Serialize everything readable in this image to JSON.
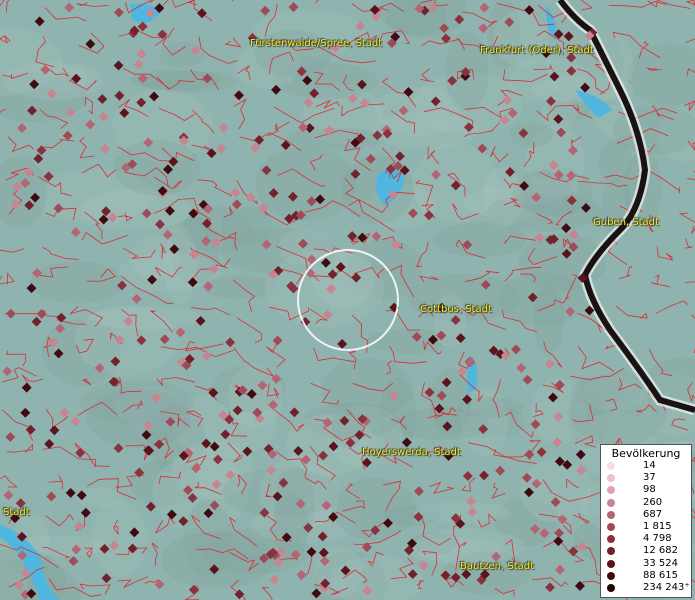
{
  "map": {
    "background_color": "#8fb3ae",
    "water_color": "#4fb6e0",
    "border_color": "#e0202a",
    "circle_color": "#ffffff"
  },
  "places": [
    {
      "id": "fuerstenwalde",
      "label": "Fürstenwalde/Spree, Stadt"
    },
    {
      "id": "frankfurt",
      "label": "Frankfurt (Oder), Stadt"
    },
    {
      "id": "guben",
      "label": "Guben, Stadt"
    },
    {
      "id": "cottbus",
      "label": "Cottbus, Stadt"
    },
    {
      "id": "hoyerswerda",
      "label": "Hoyerswerda, Stadt"
    },
    {
      "id": "bautzen",
      "label": "Bautzen, Stadt"
    },
    {
      "id": "stadt-left",
      "label": "Stadt"
    }
  ],
  "legend": {
    "title": "Bevölkerung",
    "items": [
      {
        "label": "14",
        "color": "#f7dbe6"
      },
      {
        "label": "37",
        "color": "#ecc0cd"
      },
      {
        "label": "98",
        "color": "#dba3b1"
      },
      {
        "label": "260",
        "color": "#c98492"
      },
      {
        "label": "687",
        "color": "#b46472"
      },
      {
        "label": "1 815",
        "color": "#a04a57"
      },
      {
        "label": "4 798",
        "color": "#8a3340"
      },
      {
        "label": "12 682",
        "color": "#72222d"
      },
      {
        "label": "33 524",
        "color": "#5a141d"
      },
      {
        "label": "88 615",
        "color": "#3f0a10"
      },
      {
        "label": "234 243⁺",
        "color": "#220305"
      }
    ]
  }
}
